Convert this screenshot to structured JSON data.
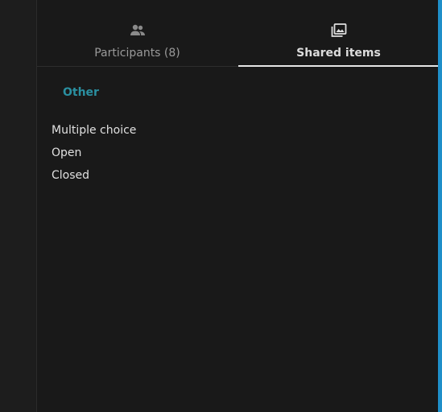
{
  "tabs": {
    "participants": {
      "label": "Participants (8)",
      "icon": "people-icon"
    },
    "shared": {
      "label": "Shared items",
      "icon": "image-gallery-icon",
      "active": true
    }
  },
  "section": {
    "title": "Other"
  },
  "items": [
    {
      "label": "Multiple choice"
    },
    {
      "label": "Open"
    },
    {
      "label": "Closed"
    }
  ],
  "colors": {
    "background": "#191919",
    "accent_teal": "#2a8fa0",
    "right_border_blue": "#1f8fc9",
    "active_underline": "#e6e6e6"
  }
}
